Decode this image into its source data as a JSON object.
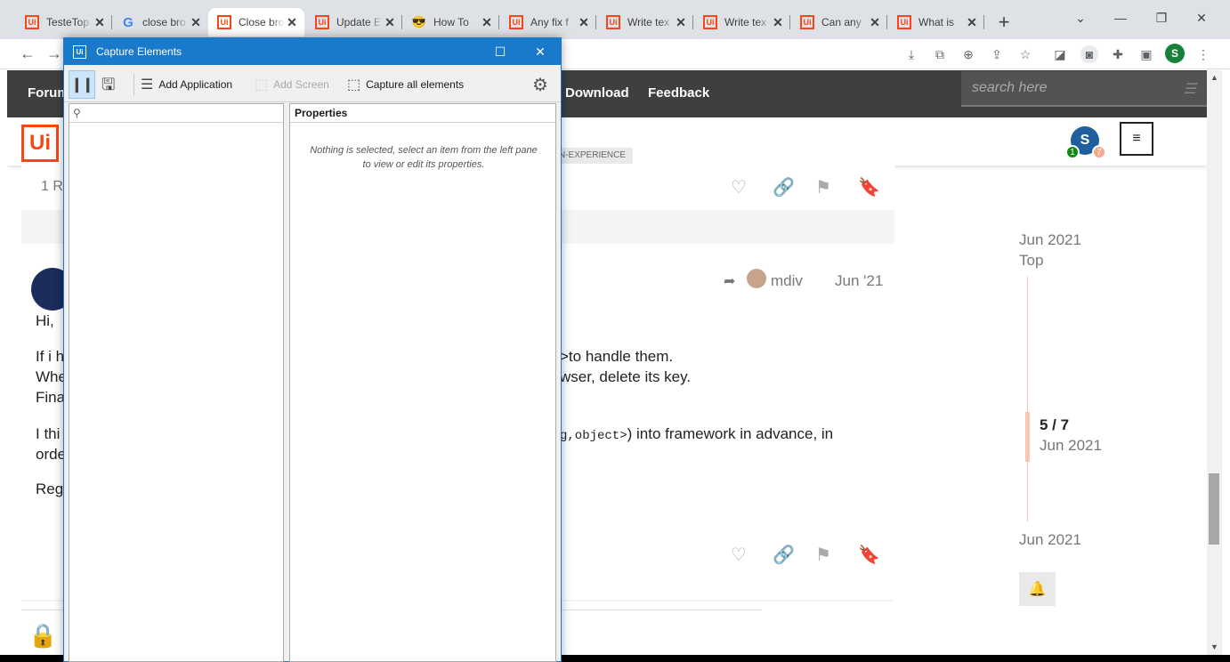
{
  "browser": {
    "tabs": [
      {
        "title": "TesteTop",
        "favicon": "uipath-icon"
      },
      {
        "title": "close bro",
        "favicon": "google-icon"
      },
      {
        "title": "Close bro",
        "favicon": "uipath-icon",
        "active": true
      },
      {
        "title": "Update E",
        "favicon": "uipath-icon"
      },
      {
        "title": "How To",
        "favicon": "emoji-icon"
      },
      {
        "title": "Any fix f",
        "favicon": "uipath-icon"
      },
      {
        "title": "Write tex",
        "favicon": "uipath-icon"
      },
      {
        "title": "Write tex",
        "favicon": "uipath-icon"
      },
      {
        "title": "Can any",
        "favicon": "uipath-icon"
      },
      {
        "title": "What is",
        "favicon": "uipath-icon"
      }
    ],
    "new_tab": "+",
    "profile_initial": "S"
  },
  "forum": {
    "nav": {
      "forum": "Forum",
      "download": "Download",
      "feedback": "Feedback"
    },
    "search_placeholder": "search here",
    "logo": "Ui",
    "tag": "N-EXPERIENCE",
    "user_initial": "S",
    "badge_green": "1",
    "badge_orange": "7",
    "hamburger": "≡",
    "post1": {
      "replies": "1 R"
    },
    "post2": {
      "reply_to": "mdiv",
      "date": "Jun '21",
      "lines": [
        "Hi,",
        "If i h",
        ">to handle them.",
        "Whe",
        "wser, delete its key.",
        "Fina",
        "I thi",
        "g,object>",
        ") into framework in advance, in",
        "orde",
        "Reg"
      ]
    },
    "timeline": {
      "start": "Jun 2021",
      "top": "Top",
      "position": "5 / 7",
      "position_date": "Jun 2021",
      "end": "Jun 2021"
    }
  },
  "dialog": {
    "title": "Capture Elements",
    "app_icon": "Ui",
    "toolbar": {
      "add_application": "Add Application",
      "add_screen": "Add Screen",
      "capture_all": "Capture all elements"
    },
    "left_pane": {
      "search_placeholder": ""
    },
    "properties": {
      "header": "Properties",
      "empty_message": "Nothing is selected, select an item from the left pane to view or edit its properties."
    }
  },
  "colors": {
    "dialog_accent": "#1979ca",
    "uipath_orange": "#fa4616",
    "forum_nav": "#3f3f3f"
  }
}
